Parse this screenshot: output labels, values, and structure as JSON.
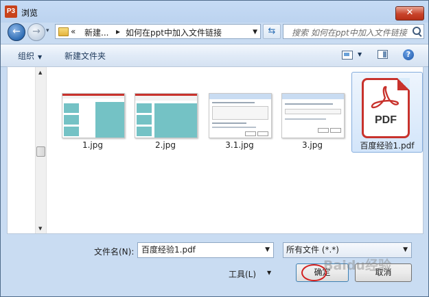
{
  "window": {
    "app_icon_text": "P3",
    "title": "浏览",
    "close_glyph": "✕"
  },
  "nav": {
    "back_glyph": "←",
    "forward_glyph": "→",
    "breadcrumb": {
      "overflow": "«",
      "items": [
        "新建...",
        "如何在ppt中加入文件链接"
      ],
      "separator": "▸"
    },
    "refresh_glyph": "⇆",
    "search_placeholder": "搜索 如何在ppt中加入文件链接"
  },
  "toolbar": {
    "organize": "组织",
    "new_folder": "新建文件夹"
  },
  "files": [
    {
      "name": "1.jpg",
      "kind": "ppt-slide"
    },
    {
      "name": "2.jpg",
      "kind": "ppt-slide"
    },
    {
      "name": "3.1.jpg",
      "kind": "dialog"
    },
    {
      "name": "3.jpg",
      "kind": "dialog"
    },
    {
      "name": "百度经验1.pdf",
      "kind": "pdf",
      "selected": true,
      "icon_text": "PDF"
    }
  ],
  "footer": {
    "filename_label": "文件名(N):",
    "filename_value": "百度经验1.pdf",
    "filetype_value": "所有文件 (*.*)",
    "tools_label": "工具(L)",
    "ok_label": "确定",
    "cancel_label": "取消"
  },
  "overlay": {
    "watermark": "Baidu经验"
  },
  "colors": {
    "titlebar": "#c6dbf5",
    "accent_red": "#c8322c",
    "thumbnail_teal": "#74c2c5"
  }
}
